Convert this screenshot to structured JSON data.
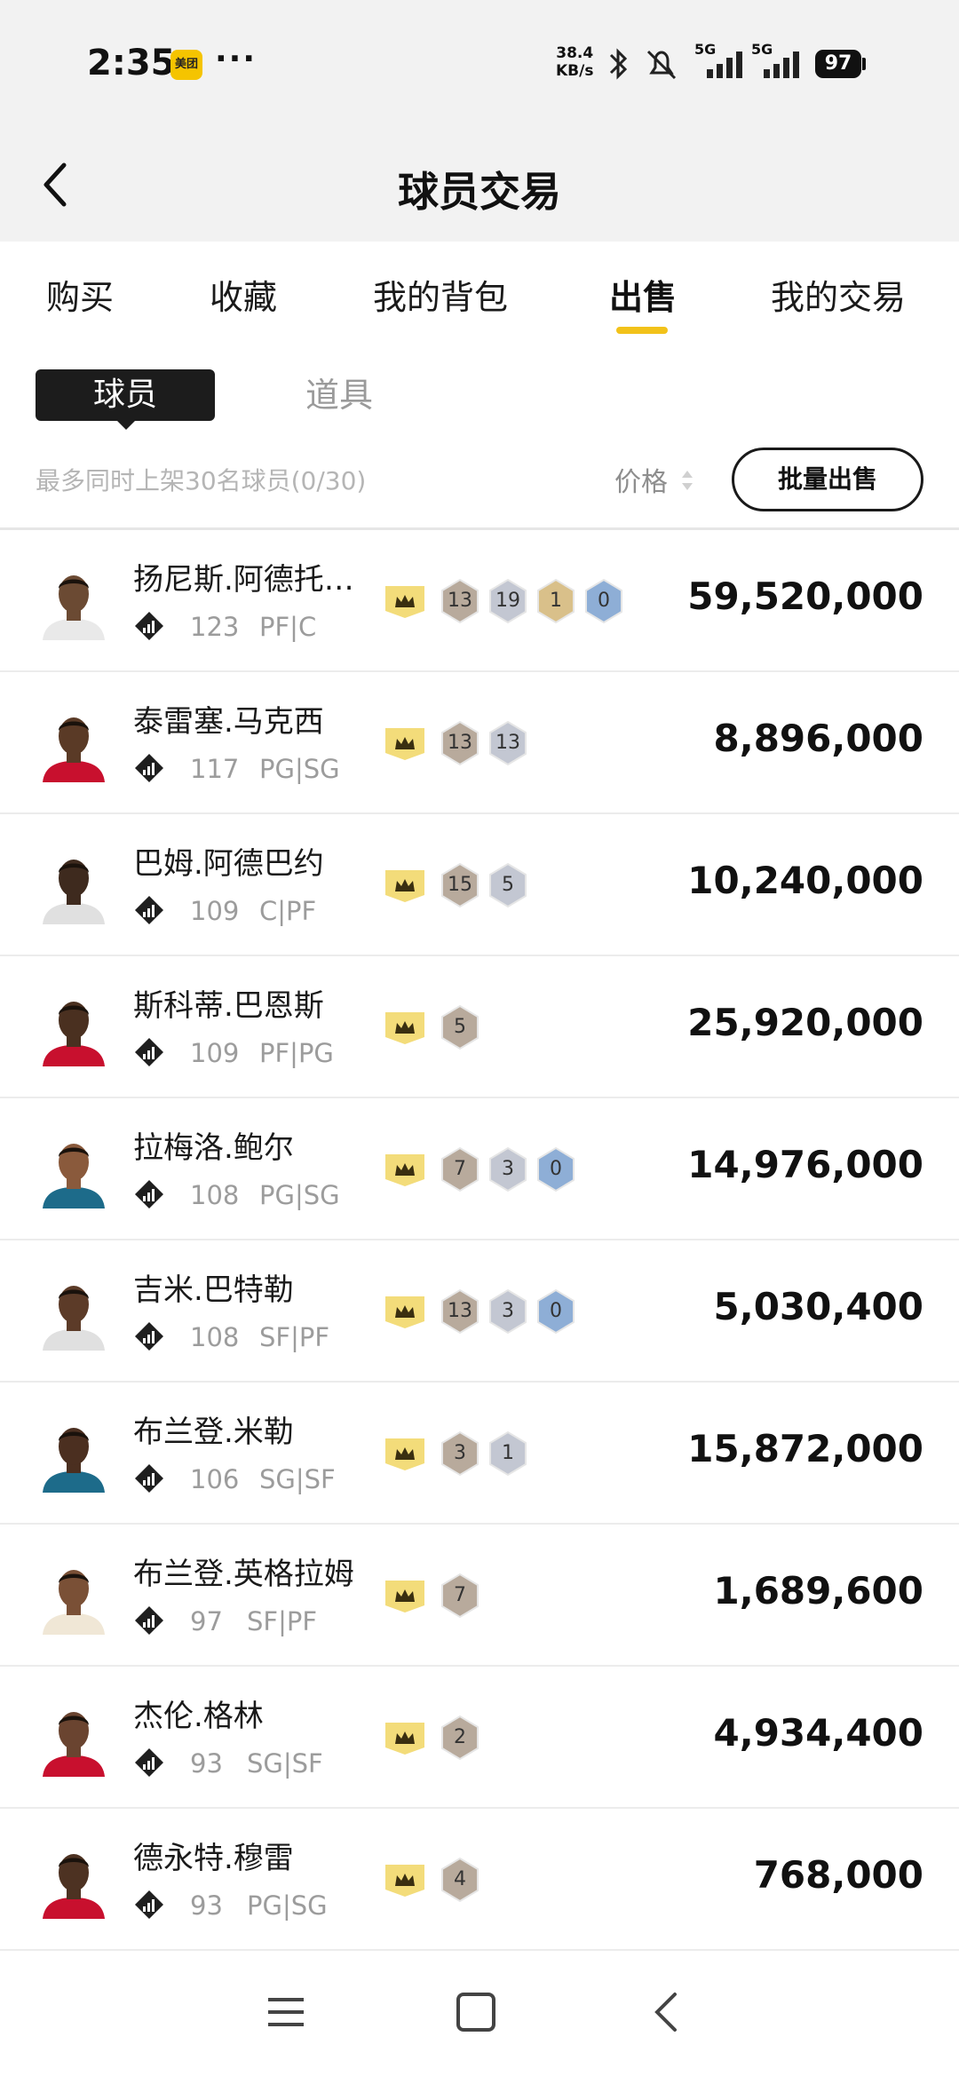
{
  "status_bar": {
    "time": "2:35",
    "app_badge": "美团",
    "more": "···",
    "net_speed_value": "38.4",
    "net_speed_unit": "KB/s",
    "signal_1": "5G",
    "signal_2": "5G",
    "battery": "97"
  },
  "header": {
    "title": "球员交易"
  },
  "tabs": [
    {
      "label": "购买",
      "active": false
    },
    {
      "label": "收藏",
      "active": false
    },
    {
      "label": "我的背包",
      "active": false
    },
    {
      "label": "出售",
      "active": true
    },
    {
      "label": "我的交易",
      "active": false
    }
  ],
  "subtabs": [
    {
      "label": "球员",
      "active": true
    },
    {
      "label": "道具",
      "active": false
    }
  ],
  "info_bar": {
    "limit_text": "最多同时上架30名球员(0/30)",
    "sort_label": "价格",
    "batch_sell_label": "批量出售"
  },
  "colors": {
    "accent": "#f2c21a",
    "crown_bg": "#f3dc7a",
    "hex_bronze": "#b8aa9c",
    "hex_silver": "#c3c7d2",
    "hex_gold": "#d9c08a",
    "hex_blue": "#8eaed6"
  },
  "players": [
    {
      "name": "扬尼斯.阿德托…",
      "rating": "123",
      "position": "PF|C",
      "badges": [
        {
          "n": "13",
          "tier": "bronze"
        },
        {
          "n": "19",
          "tier": "silver"
        },
        {
          "n": "1",
          "tier": "gold"
        },
        {
          "n": "0",
          "tier": "blue"
        }
      ],
      "price": "59,520,000"
    },
    {
      "name": "泰雷塞.马克西",
      "rating": "117",
      "position": "PG|SG",
      "badges": [
        {
          "n": "13",
          "tier": "bronze"
        },
        {
          "n": "13",
          "tier": "silver"
        }
      ],
      "price": "8,896,000"
    },
    {
      "name": "巴姆.阿德巴约",
      "rating": "109",
      "position": "C|PF",
      "badges": [
        {
          "n": "15",
          "tier": "bronze"
        },
        {
          "n": "5",
          "tier": "silver"
        }
      ],
      "price": "10,240,000"
    },
    {
      "name": "斯科蒂.巴恩斯",
      "rating": "109",
      "position": "PF|PG",
      "badges": [
        {
          "n": "5",
          "tier": "bronze"
        }
      ],
      "price": "25,920,000"
    },
    {
      "name": "拉梅洛.鲍尔",
      "rating": "108",
      "position": "PG|SG",
      "badges": [
        {
          "n": "7",
          "tier": "bronze"
        },
        {
          "n": "3",
          "tier": "silver"
        },
        {
          "n": "0",
          "tier": "blue"
        }
      ],
      "price": "14,976,000"
    },
    {
      "name": "吉米.巴特勒",
      "rating": "108",
      "position": "SF|PF",
      "badges": [
        {
          "n": "13",
          "tier": "bronze"
        },
        {
          "n": "3",
          "tier": "silver"
        },
        {
          "n": "0",
          "tier": "blue"
        }
      ],
      "price": "5,030,400"
    },
    {
      "name": "布兰登.米勒",
      "rating": "106",
      "position": "SG|SF",
      "badges": [
        {
          "n": "3",
          "tier": "bronze"
        },
        {
          "n": "1",
          "tier": "silver"
        }
      ],
      "price": "15,872,000"
    },
    {
      "name": "布兰登.英格拉姆",
      "rating": "97",
      "position": "SF|PF",
      "badges": [
        {
          "n": "7",
          "tier": "bronze"
        }
      ],
      "price": "1,689,600"
    },
    {
      "name": "杰伦.格林",
      "rating": "93",
      "position": "SG|SF",
      "badges": [
        {
          "n": "2",
          "tier": "bronze"
        }
      ],
      "price": "4,934,400"
    },
    {
      "name": "德永特.穆雷",
      "rating": "93",
      "position": "PG|SG",
      "badges": [
        {
          "n": "4",
          "tier": "bronze"
        }
      ],
      "price": "768,000"
    }
  ],
  "nav": {
    "menu_icon": "menu-icon",
    "home_icon": "home-square-icon",
    "back_icon": "back-arrow-icon"
  }
}
